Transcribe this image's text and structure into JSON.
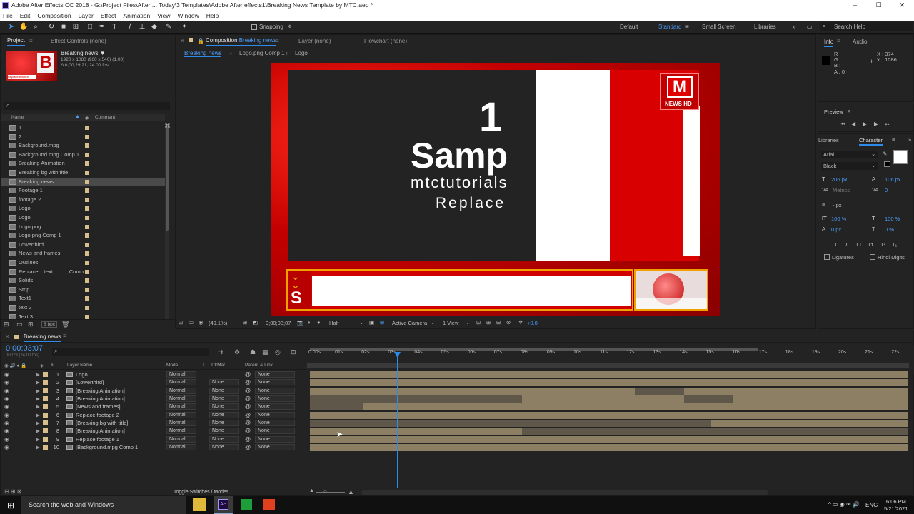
{
  "title": "Adobe After Effects CC 2018 - G:\\Project Files\\After ... Today\\3 Templates\\Adobe After effects1\\Breaking News Template by MTC.aep *",
  "window_buttons": [
    "–",
    "☐",
    "✕"
  ],
  "menu": [
    "File",
    "Edit",
    "Composition",
    "Layer",
    "Effect",
    "Animation",
    "View",
    "Window",
    "Help"
  ],
  "toolbar": {
    "snapping": "Snapping",
    "workspaces": [
      "Default",
      "Standard",
      "Small Screen",
      "Libraries"
    ],
    "active_workspace": "Standard",
    "search_placeholder": "Search Help"
  },
  "project": {
    "tabs": [
      "Project",
      "Effect Controls (none)"
    ],
    "selected_name": "Breaking news ▼",
    "selected_info1": "1920 x 1080  (960 x 540) (1.00)",
    "selected_info2": "Δ 0;00;29;21, 24.00 fps",
    "thumb_letter": "B",
    "thumb_caption": "Replace this text",
    "col_name": "Name",
    "col_comment": "Comment",
    "items": [
      "1",
      "2",
      "Background.mpg",
      "Background.mpg Comp 1",
      "Breaking Animation",
      "Breaking bg with title",
      "Breaking news",
      "Footage 1",
      "footage 2",
      "Logo",
      "Logo",
      "Logo.png",
      "Logo.png Comp 1",
      "Lowerthird",
      "News and frames",
      "Outlines",
      "Replace... text.......... Comp 1",
      "Solids",
      "Strip",
      "Text1",
      "text 2",
      "Text 3"
    ],
    "selected_index": 6,
    "bpc": "8 bpc"
  },
  "comp": {
    "tab_prefix": "Composition",
    "tab_name": "Breaking news",
    "layer_tab": "Layer  (none)",
    "flowchart_tab": "Flowchart  (none)",
    "breadcrumbs": [
      "Breaking news",
      "Logo.png Comp 1",
      "Logo"
    ],
    "text_number": "1",
    "text_sample": "Samp",
    "text_site": "mtctutorials",
    "text_replace": "Replace",
    "logo_letter": "M",
    "logo_sub": "NEWS HD",
    "footer": {
      "zoom": "(49.1%)",
      "time": "0;00;03;07",
      "quality": "Half",
      "camera": "Active Camera",
      "view": "1 View",
      "exposure": "+0.0"
    }
  },
  "info": {
    "tabs": [
      "Info",
      "Audio"
    ],
    "r": "R :",
    "g": "G :",
    "b": "B :",
    "a": "A : 0",
    "x": "X : 374",
    "y": "Y : 1086"
  },
  "preview": {
    "title": "Preview"
  },
  "character": {
    "tabs": [
      "Libraries",
      "Character"
    ],
    "font": "Arial",
    "style": "Black",
    "size": "206 px",
    "leading": "106 px",
    "kerning": "Metrics",
    "tracking": "0",
    "stroke": "- px",
    "vscale": "100 %",
    "hscale": "100 %",
    "baseline": "0 px",
    "tsume": "0 %",
    "style_buttons": [
      "T",
      "T",
      "TT",
      "Tт",
      "T¹",
      "T₁"
    ],
    "ligatures": "Ligatures",
    "hindi": "Hindi Digits"
  },
  "timeline": {
    "comp_tab": "Breaking news",
    "timecode": "0:00:03:07",
    "frames": "00079 (24.00 fps)",
    "headers": {
      "layer": "Layer Name",
      "mode": "Mode",
      "t": "T",
      "trkmat": "TrkMat",
      "parent": "Parent & Link"
    },
    "ruler": [
      "0:00s",
      "01s",
      "02s",
      "03s",
      "04s",
      "05s",
      "06s",
      "07s",
      "08s",
      "09s",
      "10s",
      "11s",
      "12s",
      "13s",
      "14s",
      "15s",
      "16s",
      "17s",
      "18s",
      "19s",
      "20s",
      "21s",
      "22s"
    ],
    "layers": [
      {
        "num": "1",
        "name": "Logo",
        "mode": "Normal",
        "trk": "",
        "parent": "None"
      },
      {
        "num": "2",
        "name": "[Lowerthird]",
        "mode": "Normal",
        "trk": "None",
        "parent": "None"
      },
      {
        "num": "3",
        "name": "[Breaking Animation]",
        "mode": "Normal",
        "trk": "None",
        "parent": "None"
      },
      {
        "num": "4",
        "name": "[Breaking Animation]",
        "mode": "Normal",
        "trk": "None",
        "parent": "None"
      },
      {
        "num": "5",
        "name": "[News and frames]",
        "mode": "Normal",
        "trk": "None",
        "parent": "None"
      },
      {
        "num": "6",
        "name": "Replace footage 2",
        "mode": "Normal",
        "trk": "None",
        "parent": "None"
      },
      {
        "num": "7",
        "name": "[Breaking bg with title]",
        "mode": "Normal",
        "trk": "None",
        "parent": "None"
      },
      {
        "num": "8",
        "name": "[Breaking Animation]",
        "mode": "Normal",
        "trk": "None",
        "parent": "None"
      },
      {
        "num": "9",
        "name": "Replace footage 1",
        "mode": "Normal",
        "trk": "None",
        "parent": "None"
      },
      {
        "num": "10",
        "name": "[Background.mpg Comp 1]",
        "mode": "Normal",
        "trk": "None",
        "parent": "None"
      }
    ],
    "toggle_label": "Toggle Switches / Modes"
  },
  "taskbar": {
    "search": "Search the web and Windows",
    "lang": "ENG",
    "time": "6:06 PM",
    "date": "5/21/2021"
  },
  "colors": {
    "accent": "#2d8ceb",
    "red": "#d10a0a",
    "tan": "#8d7f63"
  }
}
